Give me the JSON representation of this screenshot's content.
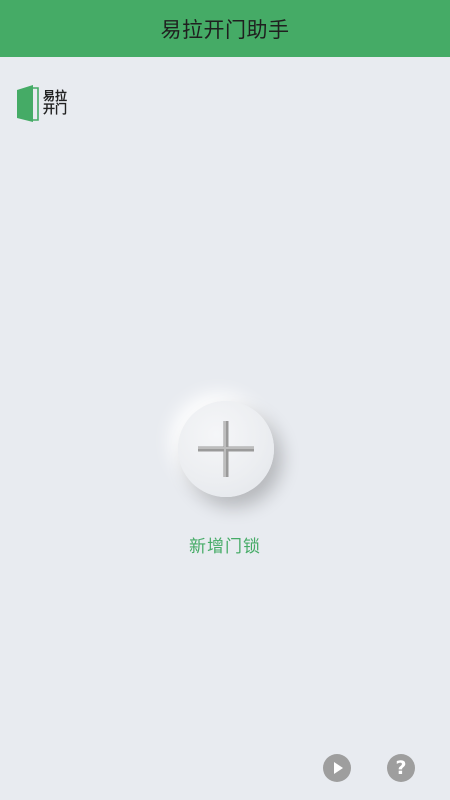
{
  "header": {
    "title": "易拉开门助手"
  },
  "brand": {
    "line1": "易拉",
    "line2": "开门"
  },
  "main": {
    "add_lock_label": "新增门锁"
  },
  "footer": {
    "play_icon": "play-icon",
    "help_glyph": "?"
  },
  "colors": {
    "brand_green": "#45ab66",
    "background": "#e8ebf0",
    "icon_gray": "#9e9e9e"
  }
}
